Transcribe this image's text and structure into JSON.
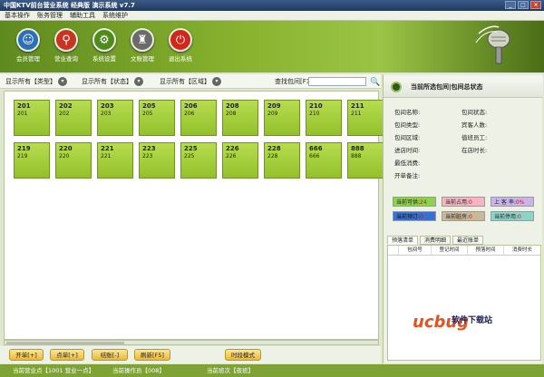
{
  "window": {
    "title": "中国KTV前台营业系统 经典版 演示系统 v7.7"
  },
  "menu": [
    "基本操作",
    "账务管理",
    "辅助工具",
    "系统维护"
  ],
  "header_buttons": [
    {
      "label": "会员管理",
      "icon": "user-icon",
      "color": "#2c6fb8"
    },
    {
      "label": "营业查询",
      "icon": "search-icon",
      "color": "#c8341f"
    },
    {
      "label": "系统设置",
      "icon": "gear-icon",
      "color": "#4e8b1c"
    },
    {
      "label": "文账管理",
      "icon": "building-icon",
      "color": "#6b6b6b"
    },
    {
      "label": "退出系统",
      "icon": "power-icon",
      "color": "#d2261c"
    }
  ],
  "filters": {
    "type": "显示所有【类型】",
    "status": "显示所有【状态】",
    "area": "显示所有【区域】",
    "search_label": "查找包间[F3]",
    "search_value": ""
  },
  "rooms": [
    {
      "num": "201",
      "sub": "201"
    },
    {
      "num": "202",
      "sub": "202"
    },
    {
      "num": "203",
      "sub": "203"
    },
    {
      "num": "205",
      "sub": "205"
    },
    {
      "num": "206",
      "sub": "206"
    },
    {
      "num": "208",
      "sub": "208"
    },
    {
      "num": "209",
      "sub": "209"
    },
    {
      "num": "210",
      "sub": "210"
    },
    {
      "num": "211",
      "sub": "211"
    },
    {
      "num": "219",
      "sub": "219"
    },
    {
      "num": "220",
      "sub": "220"
    },
    {
      "num": "221",
      "sub": "221"
    },
    {
      "num": "223",
      "sub": "223"
    },
    {
      "num": "225",
      "sub": "225"
    },
    {
      "num": "226",
      "sub": "226"
    },
    {
      "num": "228",
      "sub": "228"
    },
    {
      "num": "666",
      "sub": "666"
    },
    {
      "num": "888",
      "sub": "888"
    }
  ],
  "bottom_buttons": [
    "开单[+]",
    "点单[+]",
    "结账[-]",
    "刷新[F5]",
    "时段模式"
  ],
  "status": {
    "shift": "当前营业点【1001 营业一点】",
    "operator": "当前操作员【008】",
    "counter": "当前班次【夜班】"
  },
  "right_panel": {
    "title": "当前所选包间|包间总状态",
    "left_fields": [
      "包间名称:",
      "包间类型:",
      "包间区域:",
      "进店时间:",
      "最低消费:",
      "开单备注:"
    ],
    "right_fields": [
      "包间状态:",
      "宾客人数:",
      "值班员工:",
      "在店时长:"
    ],
    "badges": [
      {
        "label": "当前可供:",
        "value": "24",
        "bg": "#8fd14f"
      },
      {
        "label": "当前占用:",
        "value": "0",
        "bg": "#f4b6c2"
      },
      {
        "label": "上 客 率:",
        "value": "0%",
        "bg": "#c9b6e8"
      },
      {
        "label": "当前预订:",
        "value": "0",
        "bg": "#3b6fd1"
      },
      {
        "label": "当前脏房:",
        "value": "0",
        "bg": "#c8b89c"
      },
      {
        "label": "当前停用:",
        "value": "0",
        "bg": "#8fd3c8"
      }
    ],
    "tabs": [
      "预落清单",
      "消费明细",
      "最近账单"
    ],
    "table_headers": [
      "包间号",
      "登记时间",
      "预落时间",
      "消费时长"
    ]
  },
  "watermark": {
    "text": "ucbug",
    "site": "软件下载站"
  }
}
